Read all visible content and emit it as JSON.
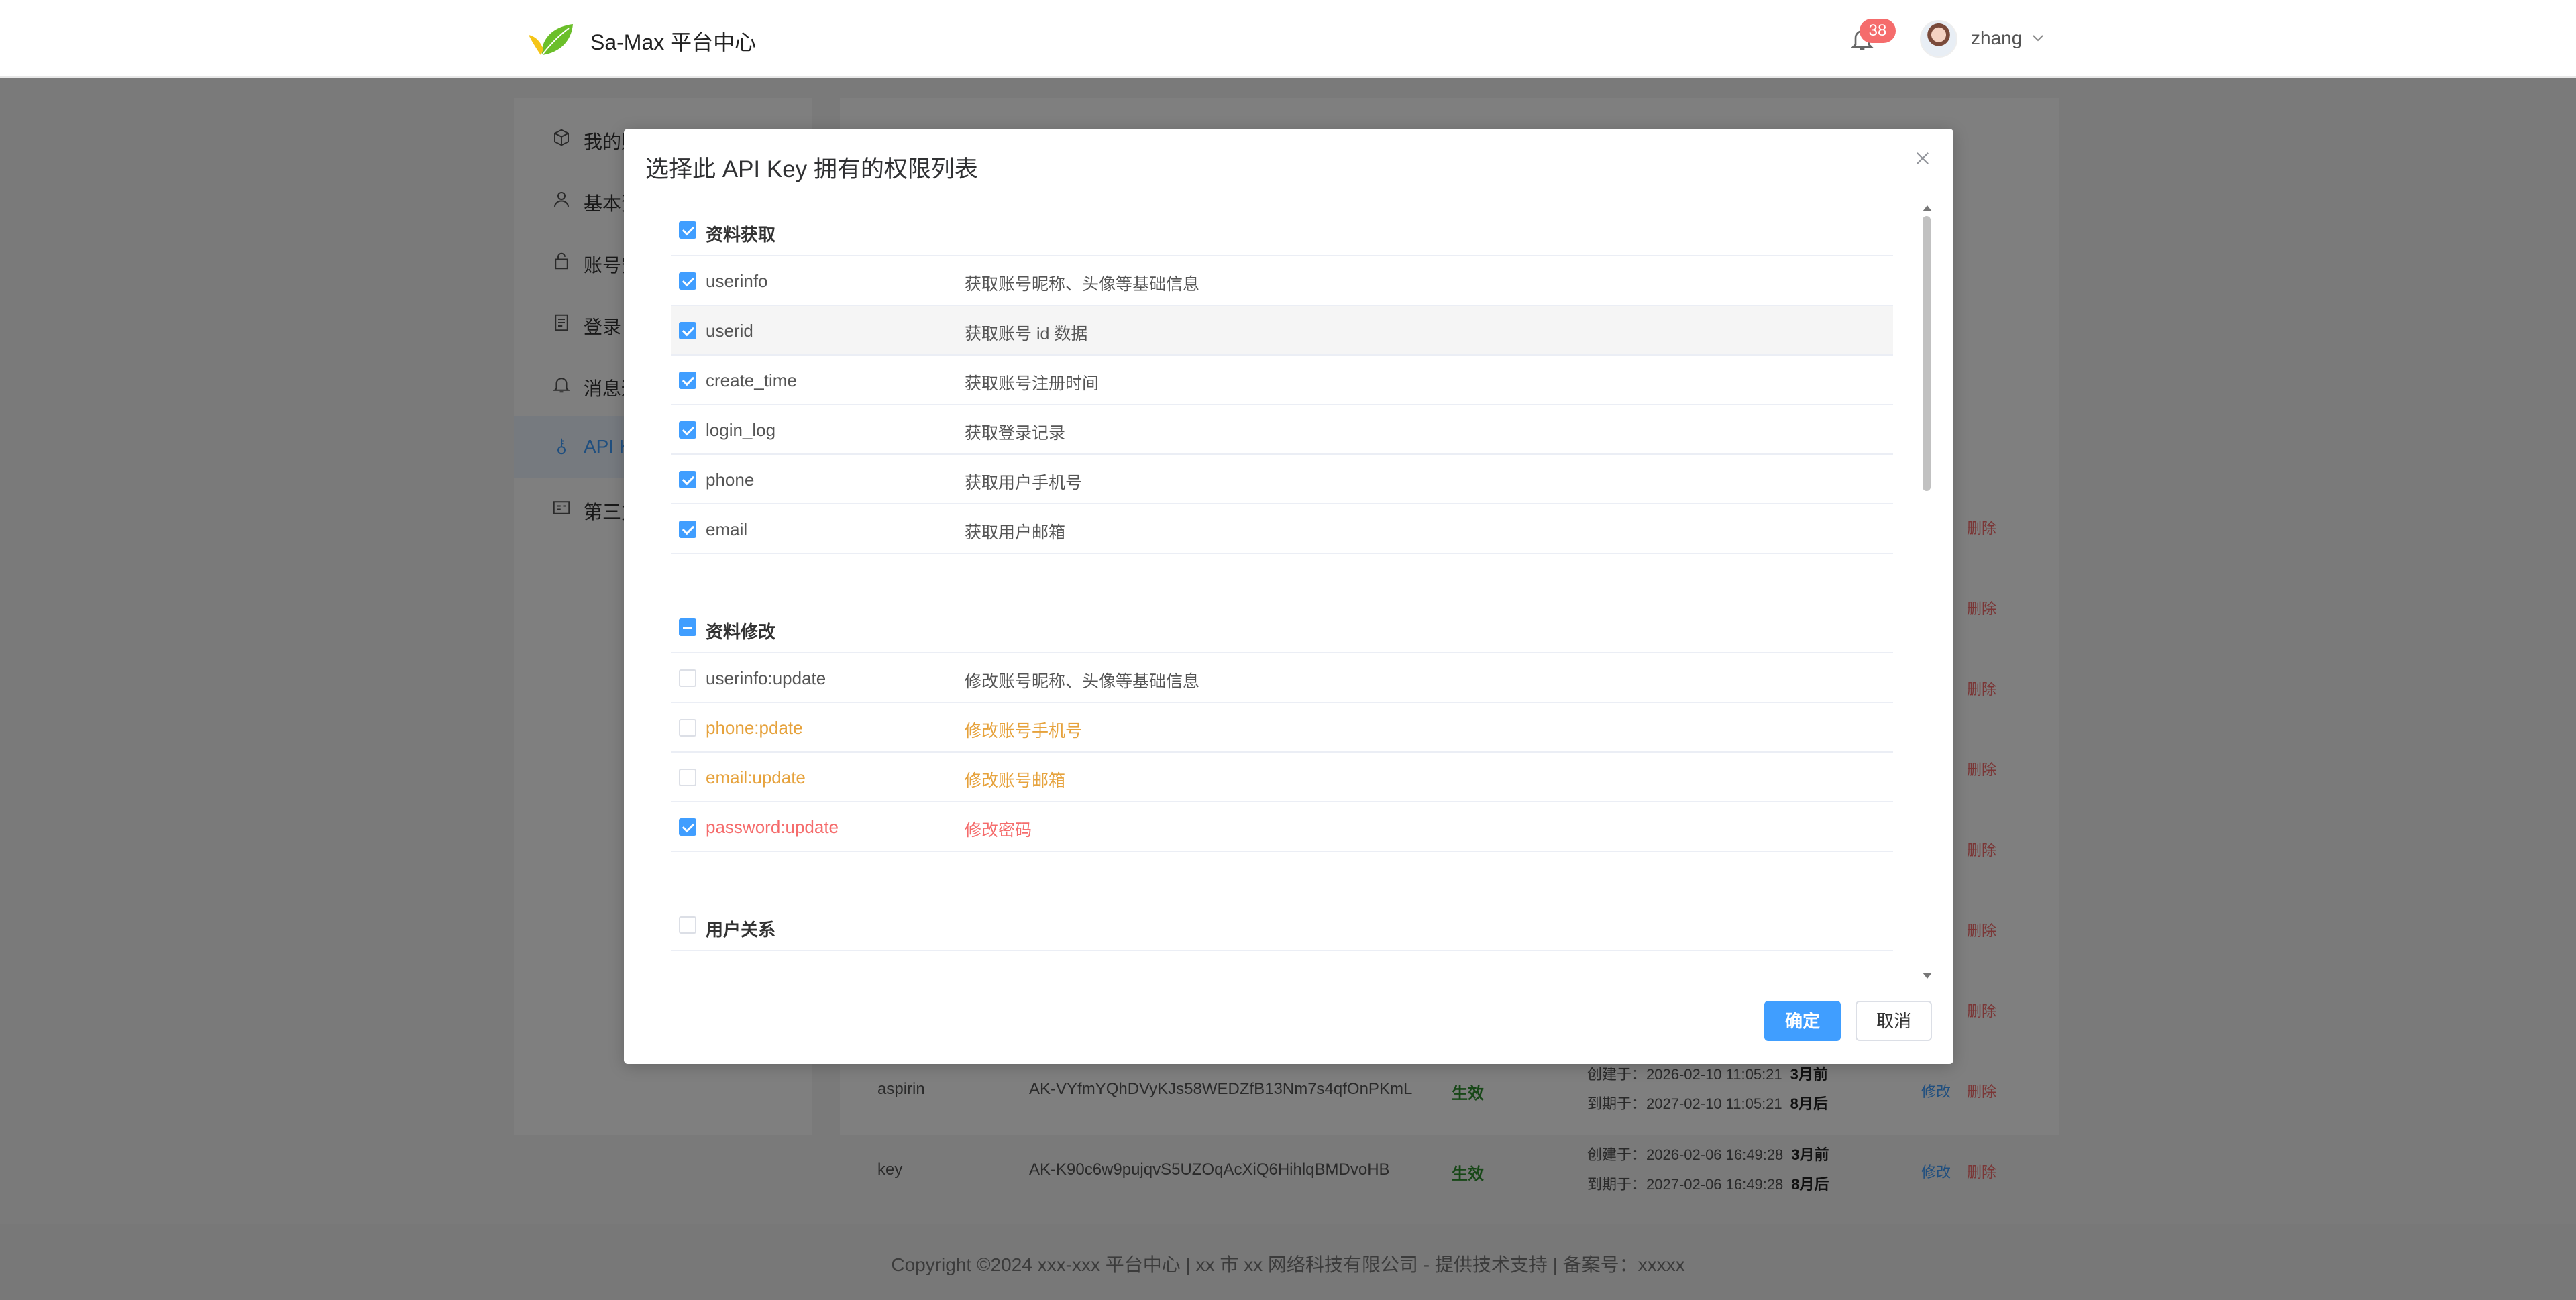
{
  "header": {
    "brand": "Sa-Max 平台中心",
    "notification_count": "38",
    "username": "zhang"
  },
  "sidebar": {
    "items": [
      {
        "label": "我的账号",
        "icon": "box-icon"
      },
      {
        "label": "基本资料",
        "icon": "user-icon"
      },
      {
        "label": "账号安全",
        "icon": "lock-icon"
      },
      {
        "label": "登录日志",
        "icon": "document-icon"
      },
      {
        "label": "消息通知",
        "icon": "bell-icon"
      },
      {
        "label": "API Key",
        "icon": "key-icon",
        "active": true
      },
      {
        "label": "第三方绑定",
        "icon": "card-icon"
      }
    ]
  },
  "background_table": {
    "rows": [
      {
        "name": "aspirin",
        "key": "AK-VYfmYQhDVyKJs58WEDZfB13Nm7s4qfOnPKmL",
        "status": "生效",
        "created_label": "创建于：2026-02-10 11:05:21",
        "created_rel": "3月前",
        "expires_label": "到期于：2027-02-10 11:05:21",
        "expires_rel": "8月后",
        "edit": "修改",
        "delete": "删除"
      },
      {
        "name": "key",
        "key": "AK-K90c6w9pujqvS5UZOqAcXiQ6HihlqBMDvoHB",
        "status": "生效",
        "created_label": "创建于：2026-02-06 16:49:28",
        "created_rel": "3月前",
        "expires_label": "到期于：2027-02-06 16:49:28",
        "expires_rel": "8月后",
        "edit": "修改",
        "delete": "删除"
      }
    ],
    "delete_label": "删除"
  },
  "dialog": {
    "title": "选择此 API Key 拥有的权限列表",
    "ok": "确定",
    "cancel": "取消",
    "sections": [
      {
        "label": "资料获取",
        "state": "checked",
        "items": [
          {
            "code": "userinfo",
            "desc": "获取账号昵称、头像等基础信息",
            "checked": true,
            "style": "normal"
          },
          {
            "code": "userid",
            "desc": "获取账号 id 数据",
            "checked": true,
            "style": "normal"
          },
          {
            "code": "create_time",
            "desc": "获取账号注册时间",
            "checked": true,
            "style": "normal"
          },
          {
            "code": "login_log",
            "desc": "获取登录记录",
            "checked": true,
            "style": "normal"
          },
          {
            "code": "phone",
            "desc": "获取用户手机号",
            "checked": true,
            "style": "normal"
          },
          {
            "code": "email",
            "desc": "获取用户邮箱",
            "checked": true,
            "style": "normal"
          }
        ]
      },
      {
        "label": "资料修改",
        "state": "indeterminate",
        "items": [
          {
            "code": "userinfo:update",
            "desc": "修改账号昵称、头像等基础信息",
            "checked": false,
            "style": "normal"
          },
          {
            "code": "phone:pdate",
            "desc": "修改账号手机号",
            "checked": false,
            "style": "warning"
          },
          {
            "code": "email:update",
            "desc": "修改账号邮箱",
            "checked": false,
            "style": "warning"
          },
          {
            "code": "password:update",
            "desc": "修改密码",
            "checked": true,
            "style": "danger"
          }
        ]
      },
      {
        "label": "用户关系",
        "state": "unchecked",
        "items": []
      }
    ]
  },
  "footer": {
    "text": "Copyright ©2024 xxx-xxx 平台中心 | xx 市 xx 网络科技有限公司 - 提供技术支持 | 备案号：xxxxx"
  },
  "colors": {
    "primary": "#409eff",
    "warning": "#e6a23c",
    "danger": "#f56c6c",
    "success": "#2f8f2f"
  }
}
